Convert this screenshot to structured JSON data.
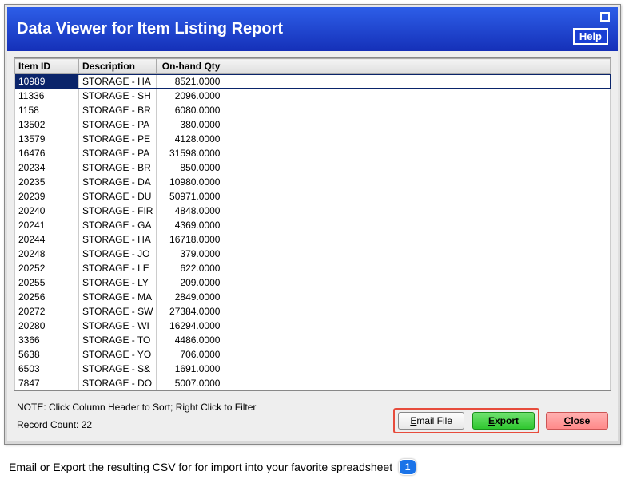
{
  "window": {
    "title": "Data Viewer for Item Listing Report",
    "helpLabel": "Help"
  },
  "table": {
    "headers": {
      "id": "Item ID",
      "desc": "Description",
      "qty": "On-hand Qty"
    },
    "rows": [
      {
        "id": "10989",
        "desc": "STORAGE - HA",
        "qty": "8521.0000",
        "selected": true
      },
      {
        "id": "11336",
        "desc": "STORAGE - SH",
        "qty": "2096.0000"
      },
      {
        "id": "1158",
        "desc": "STORAGE - BR",
        "qty": "6080.0000"
      },
      {
        "id": "13502",
        "desc": "STORAGE - PA",
        "qty": "380.0000"
      },
      {
        "id": "13579",
        "desc": "STORAGE - PE",
        "qty": "4128.0000"
      },
      {
        "id": "16476",
        "desc": "STORAGE - PA",
        "qty": "31598.0000"
      },
      {
        "id": "20234",
        "desc": "STORAGE - BR",
        "qty": "850.0000"
      },
      {
        "id": "20235",
        "desc": "STORAGE - DA",
        "qty": "10980.0000"
      },
      {
        "id": "20239",
        "desc": "STORAGE - DU",
        "qty": "50971.0000"
      },
      {
        "id": "20240",
        "desc": "STORAGE - FIR",
        "qty": "4848.0000"
      },
      {
        "id": "20241",
        "desc": "STORAGE - GA",
        "qty": "4369.0000"
      },
      {
        "id": "20244",
        "desc": "STORAGE - HA",
        "qty": "16718.0000"
      },
      {
        "id": "20248",
        "desc": "STORAGE - JO",
        "qty": "379.0000"
      },
      {
        "id": "20252",
        "desc": "STORAGE - LE",
        "qty": "622.0000"
      },
      {
        "id": "20255",
        "desc": "STORAGE - LY",
        "qty": "209.0000"
      },
      {
        "id": "20256",
        "desc": "STORAGE - MA",
        "qty": "2849.0000"
      },
      {
        "id": "20272",
        "desc": "STORAGE - SW",
        "qty": "27384.0000"
      },
      {
        "id": "20280",
        "desc": "STORAGE - WI",
        "qty": "16294.0000"
      },
      {
        "id": "3366",
        "desc": "STORAGE - TO",
        "qty": "4486.0000"
      },
      {
        "id": "5638",
        "desc": "STORAGE - YO",
        "qty": "706.0000"
      },
      {
        "id": "6503",
        "desc": "STORAGE - S&",
        "qty": "1691.0000"
      },
      {
        "id": "7847",
        "desc": "STORAGE - DO",
        "qty": "5007.0000"
      }
    ]
  },
  "footer": {
    "note": "NOTE: Click Column Header to Sort; Right Click to Filter",
    "recordCountLabel": "Record Count: 22",
    "emailLabel": "Email File",
    "exportLabel": "Export",
    "closeLabel": "Close"
  },
  "caption": {
    "text": "Email or Export the resulting CSV for for import into your favorite spreadsheet",
    "number": "1"
  }
}
